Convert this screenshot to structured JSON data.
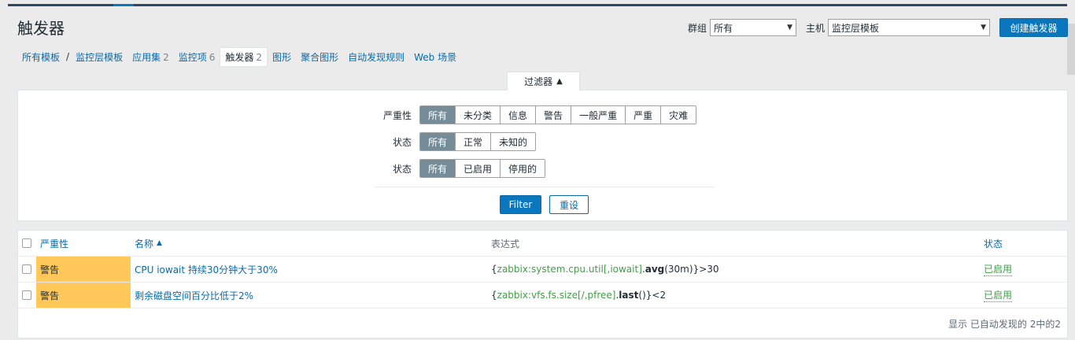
{
  "page": {
    "title": "触发器",
    "group_label": "群组",
    "group_value": "所有",
    "host_label": "主机",
    "host_value": "监控层模板",
    "create_button": "创建触发器"
  },
  "nav": {
    "all_templates": "所有模板",
    "separator": "/",
    "template": "监控层模板",
    "apps": "应用集",
    "apps_count": "2",
    "items": "监控项",
    "items_count": "6",
    "triggers": "触发器",
    "triggers_count": "2",
    "graphs": "图形",
    "screens": "聚合图形",
    "discovery": "自动发现规则",
    "web": "Web 场景"
  },
  "filter": {
    "tab_label": "过滤器",
    "tab_arrow": "▲",
    "severity_label": "严重性",
    "severity_options": [
      "所有",
      "未分类",
      "信息",
      "警告",
      "一般严重",
      "严重",
      "灾难"
    ],
    "state_label": "状态",
    "state_options": [
      "所有",
      "正常",
      "未知的"
    ],
    "status_label": "状态",
    "status_options": [
      "所有",
      "已启用",
      "停用的"
    ],
    "apply_button": "Filter",
    "reset_button": "重设"
  },
  "table": {
    "headers": {
      "severity": "严重性",
      "name": "名称",
      "sort_arrow": "▲",
      "expression": "表达式",
      "status": "状态"
    },
    "rows": [
      {
        "severity": "警告",
        "name": "CPU iowait 持续30分钟大于30%",
        "expr_open": "{",
        "expr_key": "zabbix:system.cpu.util[,iowait]",
        "expr_dot": ".",
        "expr_func": "avg",
        "expr_args": "(30m)",
        "expr_close": "}>30",
        "status": "已启用"
      },
      {
        "severity": "警告",
        "name": "剩余磁盘空间百分比低于2%",
        "expr_open": "{",
        "expr_key": "zabbix:vfs.fs.size[/,pfree]",
        "expr_dot": ".",
        "expr_func": "last",
        "expr_args": "()",
        "expr_close": "}<2",
        "status": "已启用"
      }
    ],
    "footer": "显示 已自动发现的 2中的2"
  },
  "colors": {
    "accent": "#0a76bd",
    "warning": "#ffc859",
    "enabled": "#429e47",
    "segment_active": "#768d99"
  }
}
